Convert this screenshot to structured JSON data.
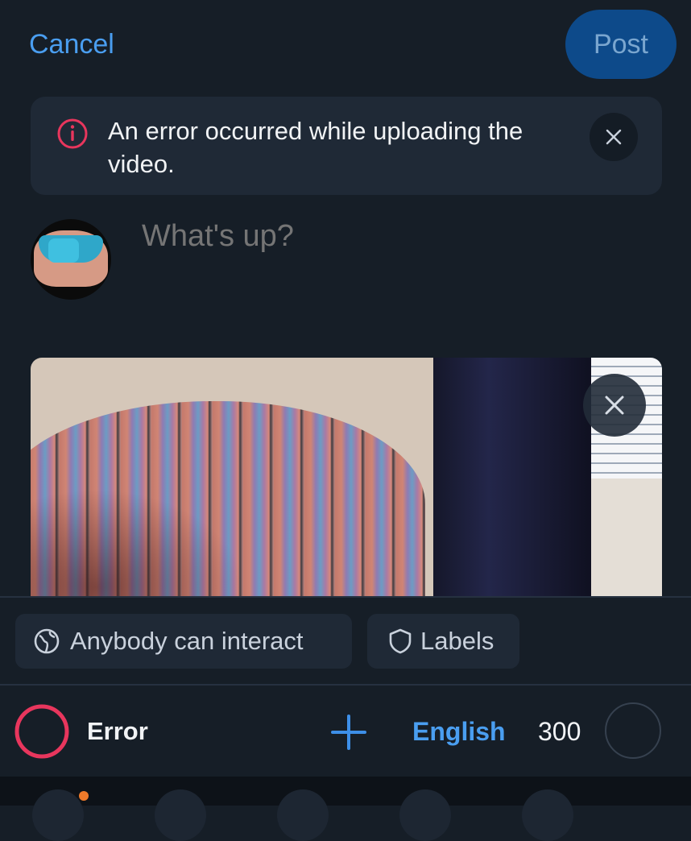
{
  "header": {
    "cancel_label": "Cancel",
    "post_label": "Post"
  },
  "error_banner": {
    "message": "An error occurred while uploading the video."
  },
  "composer": {
    "placeholder": "What's up?"
  },
  "chips": {
    "interaction_label": "Anybody can interact",
    "labels_label": "Labels"
  },
  "footer": {
    "status": "Error",
    "language": "English",
    "char_count": "300"
  },
  "colors": {
    "accent": "#4a9ef0",
    "post_button": "#0d4a8a",
    "error": "#e8365d",
    "background": "#161e27",
    "surface": "#1f2936"
  },
  "icons": [
    "info-icon",
    "close-icon",
    "globe-icon",
    "shield-icon",
    "plus-icon"
  ]
}
